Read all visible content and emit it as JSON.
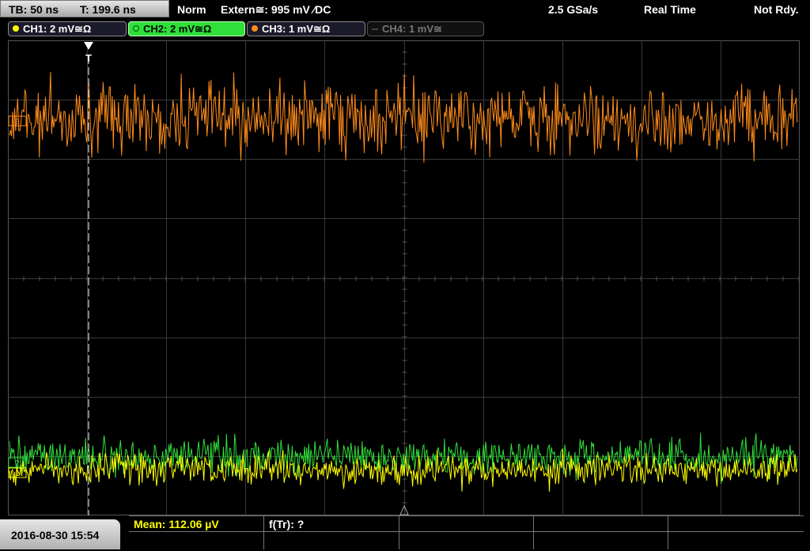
{
  "status": {
    "timebase": "TB: 50 ns",
    "trigger_time": "T: 199.6 ns",
    "mode": "Norm",
    "trigger": "Extern≅: 995 mV ⁄DC",
    "sample_rate": "2.5 GSa/s",
    "acq_mode": "Real Time",
    "state": "Not Rdy."
  },
  "channels": [
    {
      "label": "CH1: 2 mV≅Ω",
      "color": "#ffff00"
    },
    {
      "label": "CH2: 2 mV≅Ω",
      "color": "#2fe03a"
    },
    {
      "label": "CH3: 1 mV≅Ω",
      "color": "#ff8c1a"
    },
    {
      "label": "CH4: 1 mV≅",
      "color": "#666666"
    }
  ],
  "markers": {
    "ch3_level": "3",
    "ch2_level": "2",
    "ch1_level": "1",
    "trigger_label": "T"
  },
  "measurements": {
    "mean": "Mean: 112.06 µV",
    "freq": "f(Tr): ?"
  },
  "datetime": "2016-08-30 15:54"
}
